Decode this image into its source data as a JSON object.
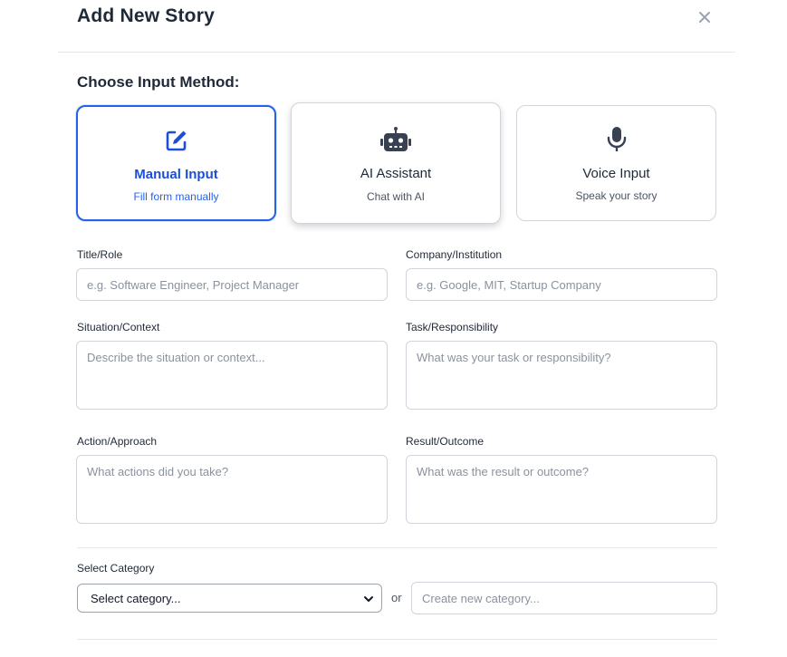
{
  "modal": {
    "title": "Add New Story",
    "close_icon": "close-icon"
  },
  "input_method": {
    "label": "Choose Input Method:",
    "options": [
      {
        "name": "Manual Input",
        "description": "Fill form manually",
        "icon": "edit-icon",
        "selected": true
      },
      {
        "name": "AI Assistant",
        "description": "Chat with AI",
        "icon": "robot-icon",
        "selected": false
      },
      {
        "name": "Voice Input",
        "description": "Speak your story",
        "icon": "microphone-icon",
        "selected": false
      }
    ]
  },
  "form": {
    "title_role": {
      "label": "Title/Role",
      "placeholder": "e.g. Software Engineer, Project Manager"
    },
    "company": {
      "label": "Company/Institution",
      "placeholder": "e.g. Google, MIT, Startup Company"
    },
    "situation": {
      "label": "Situation/Context",
      "placeholder": "Describe the situation or context..."
    },
    "task": {
      "label": "Task/Responsibility",
      "placeholder": "What was your task or responsibility?"
    },
    "action": {
      "label": "Action/Approach",
      "placeholder": "What actions did you take?"
    },
    "result": {
      "label": "Result/Outcome",
      "placeholder": "What was the result or outcome?"
    }
  },
  "category": {
    "label": "Select Category",
    "selected": "Select category...",
    "or_text": "or",
    "new_placeholder": "Create new category..."
  },
  "colors": {
    "accent": "#2563eb",
    "border": "#d1d5db",
    "text": "#1f2937"
  }
}
